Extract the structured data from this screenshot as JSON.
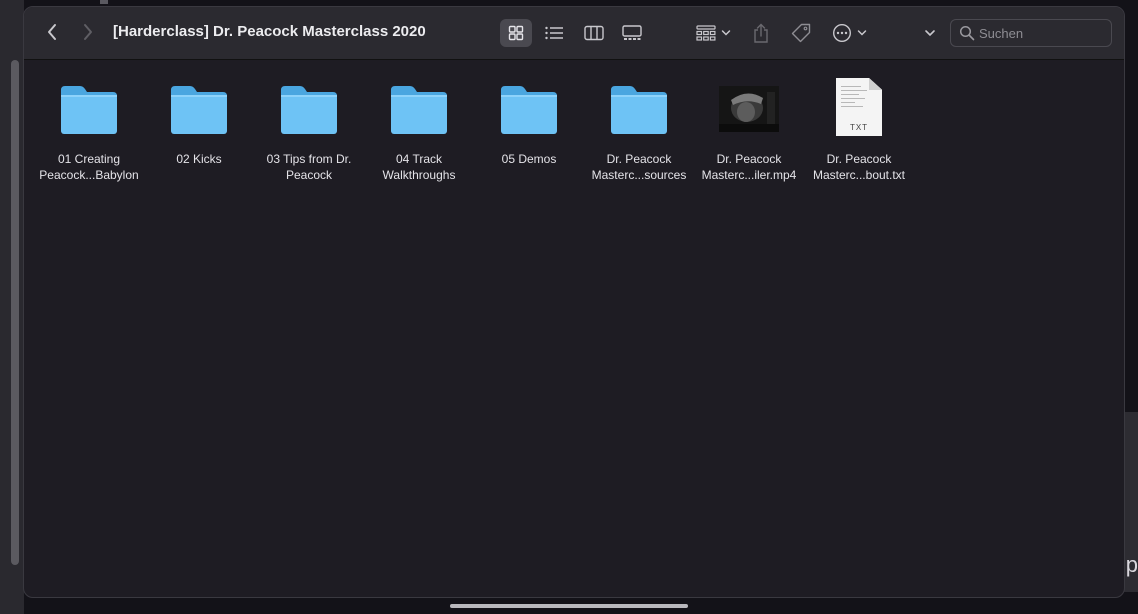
{
  "window": {
    "title": "[Harderclass] Dr. Peacock Masterclass 2020"
  },
  "toolbar": {
    "back_icon": "chevron-left-icon",
    "forward_icon": "chevron-right-icon",
    "view_icons": [
      "grid-view-icon",
      "list-view-icon",
      "column-view-icon",
      "gallery-view-icon"
    ],
    "active_view": "icon",
    "group_icon": "group-by-icon",
    "share_icon": "share-icon",
    "tag_icon": "tag-icon",
    "more_icon": "ellipsis-circle-icon",
    "expand_icon": "chevron-down-icon"
  },
  "search": {
    "placeholder": "Suchen"
  },
  "items": [
    {
      "kind": "folder",
      "line1": "01 Creating",
      "line2": "Peacock...Babylon"
    },
    {
      "kind": "folder",
      "line1": "02 Kicks",
      "line2": ""
    },
    {
      "kind": "folder",
      "line1": "03 Tips from Dr.",
      "line2": "Peacock"
    },
    {
      "kind": "folder",
      "line1": "04 Track",
      "line2": "Walkthroughs"
    },
    {
      "kind": "folder",
      "line1": "05 Demos",
      "line2": ""
    },
    {
      "kind": "folder",
      "line1": "Dr. Peacock",
      "line2": "Masterc...sources"
    },
    {
      "kind": "video",
      "line1": "Dr. Peacock",
      "line2": "Masterc...iler.mp4"
    },
    {
      "kind": "txt",
      "line1": "Dr. Peacock",
      "line2": "Masterc...bout.txt",
      "badge": "TXT"
    }
  ],
  "background": {
    "right_edge_text": "ip"
  },
  "colors": {
    "folder": "#6ec3f5",
    "folder_dark": "#4aa6e0",
    "window_bg": "#1e1c23",
    "toolbar_bg": "#2b2a30"
  }
}
